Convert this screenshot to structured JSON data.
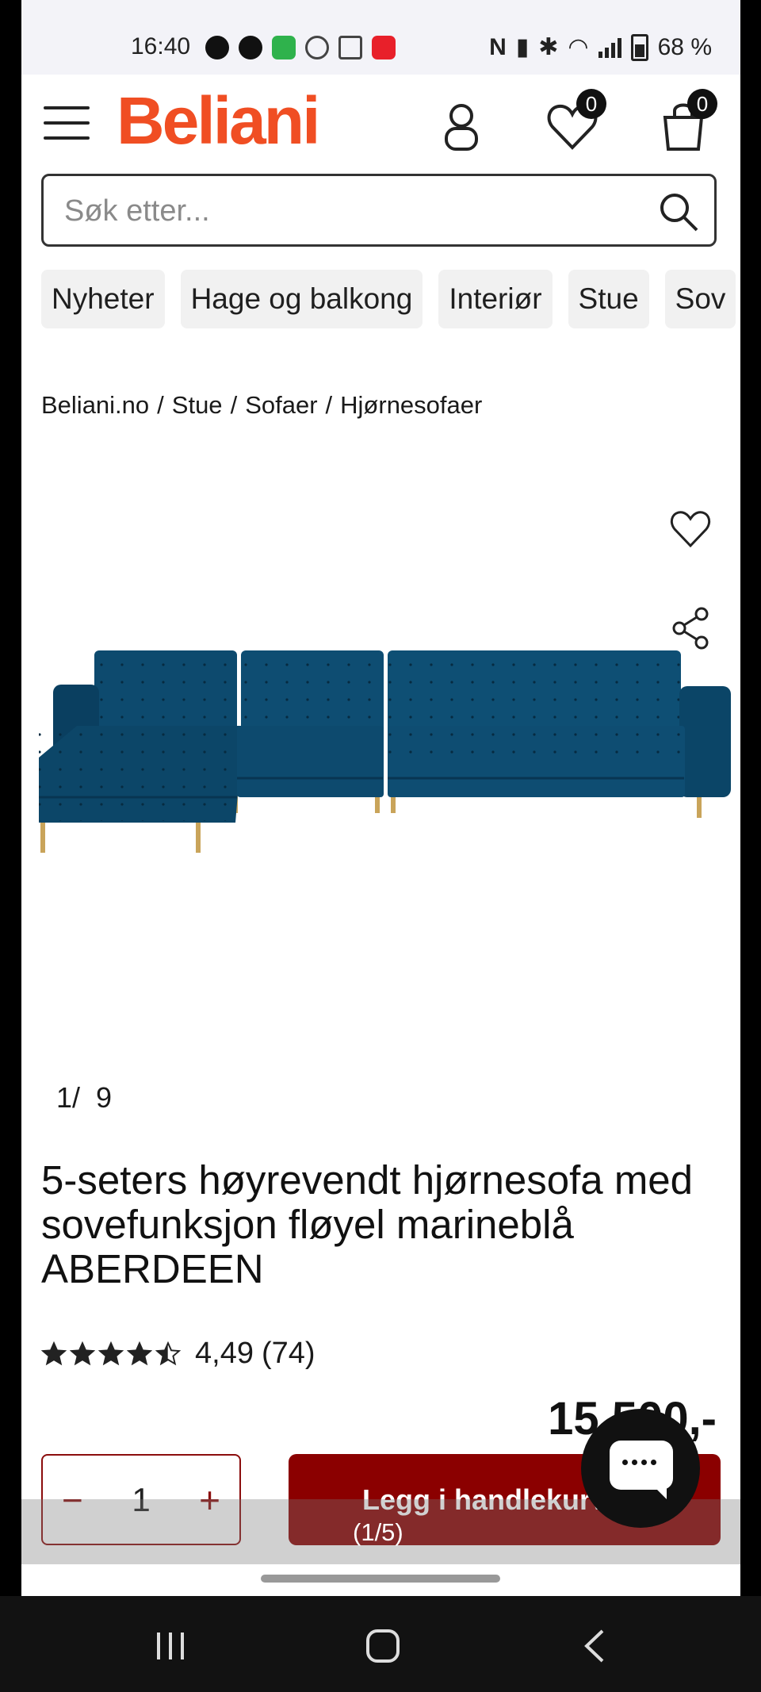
{
  "status_bar": {
    "time": "16:40",
    "battery": "68 %"
  },
  "header": {
    "logo": "Beliani",
    "wishlist_count": "0",
    "cart_count": "0"
  },
  "search": {
    "placeholder": "Søk etter..."
  },
  "categories": [
    "Nyheter",
    "Hage og balkong",
    "Interiør",
    "Stue",
    "Sov"
  ],
  "breadcrumb": [
    "Beliani.no",
    "Stue",
    "Sofaer",
    "Hjørnesofaer"
  ],
  "gallery": {
    "current": "1",
    "total": "9"
  },
  "product": {
    "title": "5-seters høyrevendt hjørnesofa med sovefunksjon fløyel marineblå ABERDEEN",
    "rating_value": "4,49",
    "rating_count": "(74)",
    "stars": 4.49,
    "price": "15 500,-"
  },
  "cart": {
    "quantity": "1",
    "add_label": "Legg i handlekurv"
  },
  "overlay": {
    "page_indicator": "(1/5)"
  },
  "colors": {
    "brand": "#f04e23",
    "cta": "#8b0000",
    "sofa": "#0d4a6e"
  }
}
